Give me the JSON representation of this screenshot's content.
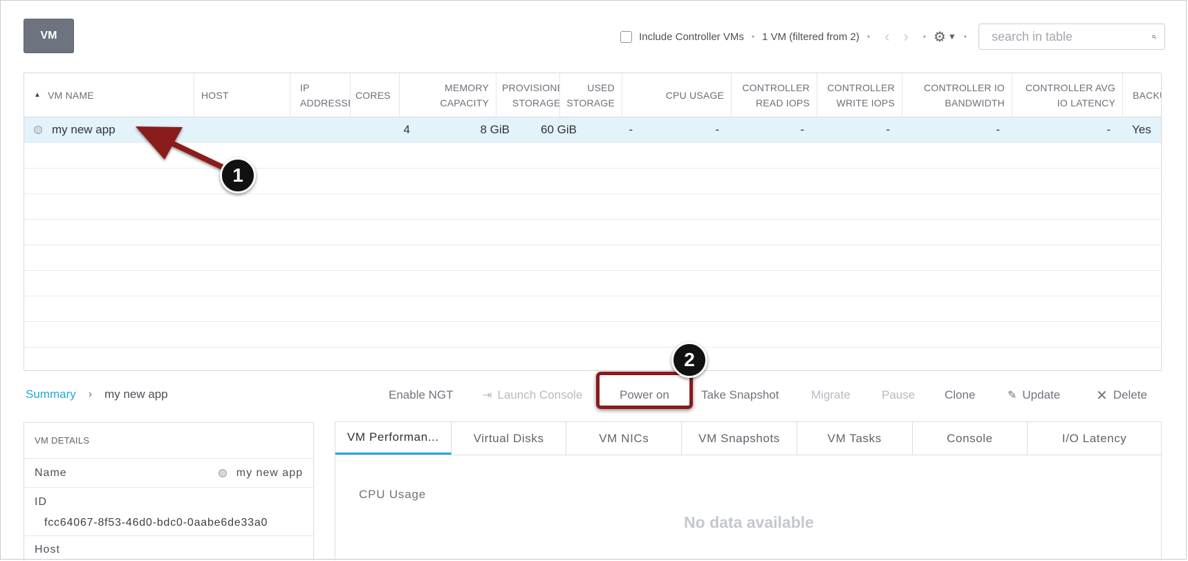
{
  "toolbar": {
    "vm_button": "VM",
    "include_controller_label": "Include Controller VMs",
    "vm_count": "1 VM (filtered from 2)",
    "search_placeholder": "search in table"
  },
  "table": {
    "columns": [
      {
        "line1": "VM NAME",
        "line2": ""
      },
      {
        "line1": "HOST",
        "line2": ""
      },
      {
        "line1": "IP",
        "line2": "ADDRESSES"
      },
      {
        "line1": "CORES",
        "line2": ""
      },
      {
        "line1": "MEMORY",
        "line2": "CAPACITY"
      },
      {
        "line1": "PROVISIONED",
        "line2": "STORAGE"
      },
      {
        "line1": "USED",
        "line2": "STORAGE"
      },
      {
        "line1": "CPU USAGE",
        "line2": ""
      },
      {
        "line1": "CONTROLLER",
        "line2": "READ IOPS"
      },
      {
        "line1": "CONTROLLER",
        "line2": "WRITE IOPS"
      },
      {
        "line1": "CONTROLLER IO",
        "line2": "BANDWIDTH"
      },
      {
        "line1": "CONTROLLER AVG",
        "line2": "IO LATENCY"
      },
      {
        "line1": "BACKU...",
        "line2": ""
      }
    ],
    "rows": [
      {
        "vm_name": "my new app",
        "host": "",
        "ip": "",
        "cores": "4",
        "memory": "8 GiB",
        "provisioned": "60 GiB",
        "used": "-",
        "cpu": "-",
        "read_iops": "-",
        "write_iops": "-",
        "io_bandwidth": "-",
        "io_latency": "-",
        "backup": "Yes"
      }
    ],
    "empty_rows": 9
  },
  "breadcrumb": {
    "root": "Summary",
    "current": "my new app"
  },
  "actions": {
    "enable_ngt": "Enable NGT",
    "launch_console": "Launch Console",
    "power_on": "Power on",
    "take_snapshot": "Take Snapshot",
    "migrate": "Migrate",
    "pause": "Pause",
    "clone": "Clone",
    "update": "Update",
    "delete": "Delete"
  },
  "vm_details": {
    "header": "VM DETAILS",
    "name_label": "Name",
    "name_value": "my new app",
    "id_label": "ID",
    "id_value": "fcc64067-8f53-46d0-bdc0-0aabe6de33a0",
    "host_label": "Host"
  },
  "tabs": [
    "VM Performan...",
    "Virtual Disks",
    "VM NICs",
    "VM Snapshots",
    "VM Tasks",
    "Console",
    "I/O Latency"
  ],
  "performance": {
    "cpu_label": "CPU Usage",
    "no_data": "No data available"
  },
  "annotations": {
    "step1": "1",
    "step2": "2"
  },
  "colors": {
    "accent": "#26a7d9",
    "annotation_red": "#8b1a1a",
    "selected_row": "#e2f3fa"
  }
}
